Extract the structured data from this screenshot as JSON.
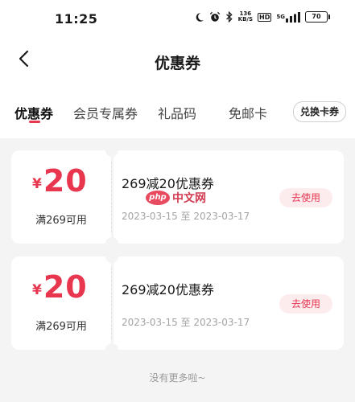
{
  "status_bar": {
    "time": "11:25",
    "net_speed_value": "136",
    "net_speed_unit": "KB/S",
    "hd": "HD",
    "signal_label": "5G",
    "battery": "70",
    "icons": [
      "moon-icon",
      "alarm-icon",
      "bluetooth-icon",
      "signal-icon",
      "battery-icon"
    ]
  },
  "nav": {
    "title": "优惠券"
  },
  "tabs": [
    {
      "label": "优惠券",
      "active": true
    },
    {
      "label": "会员专属券",
      "active": false
    },
    {
      "label": "礼品码",
      "active": false
    },
    {
      "label": "免邮卡",
      "active": false
    }
  ],
  "exchange_button": "兑换卡券",
  "coupons": [
    {
      "currency": "¥",
      "amount": "20",
      "condition": "满269可用",
      "title": "269减20优惠券",
      "date_range": "2023-03-15 至 2023-03-17",
      "action": "去使用"
    },
    {
      "currency": "¥",
      "amount": "20",
      "condition": "满269可用",
      "title": "269减20优惠券",
      "date_range": "2023-03-15 至 2023-03-17",
      "action": "去使用"
    }
  ],
  "footer": "没有更多啦~",
  "watermark": {
    "logo": "php",
    "text": "中文网"
  },
  "colors": {
    "accent": "#e8364f",
    "accent_light": "#fdecee",
    "page_bg": "#f4f4f4"
  }
}
